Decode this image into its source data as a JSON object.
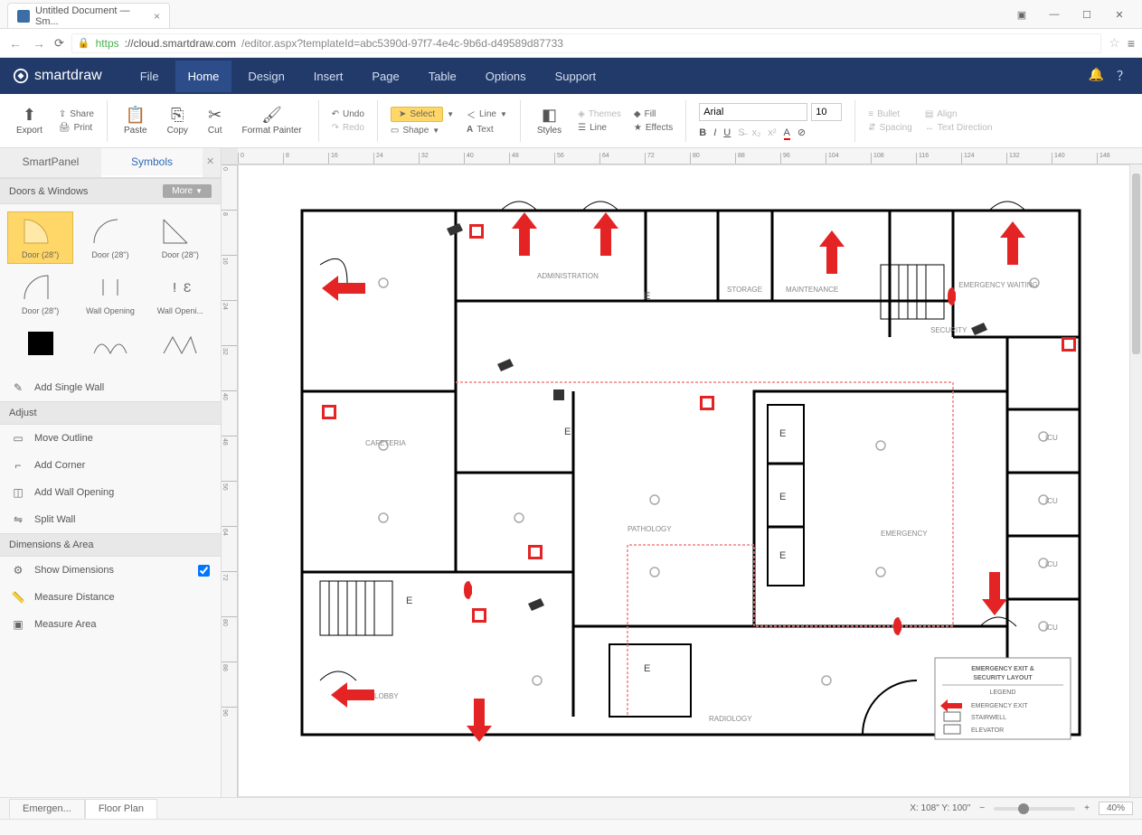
{
  "browser": {
    "tab_title": "Untitled Document — Sm...",
    "url_https": "https",
    "url_host": "://cloud.smartdraw.com",
    "url_path": "/editor.aspx?templateId=abc5390d-97f7-4e4c-9b6d-d49589d87733"
  },
  "app": {
    "brand": "smartdraw",
    "menu": [
      "File",
      "Home",
      "Design",
      "Insert",
      "Page",
      "Table",
      "Options",
      "Support"
    ],
    "menu_active": "Home"
  },
  "ribbon": {
    "export": "Export",
    "share": "Share",
    "print": "Print",
    "paste": "Paste",
    "copy": "Copy",
    "cut": "Cut",
    "format_painter": "Format Painter",
    "undo": "Undo",
    "redo": "Redo",
    "select": "Select",
    "shape": "Shape",
    "line": "Line",
    "text": "Text",
    "styles": "Styles",
    "themes": "Themes",
    "line2": "Line",
    "fill": "Fill",
    "effects": "Effects",
    "font_name": "Arial",
    "font_size": "10",
    "bullet": "Bullet",
    "align": "Align",
    "spacing": "Spacing",
    "text_direction": "Text Direction"
  },
  "sidepanel": {
    "tabs": [
      "SmartPanel",
      "Symbols"
    ],
    "tabs_active": "Symbols",
    "section_doors": "Doors & Windows",
    "more": "More",
    "symbols": [
      {
        "label": "Door (28\")",
        "selected": true
      },
      {
        "label": "Door (28\")"
      },
      {
        "label": "Door (28\")"
      },
      {
        "label": "Door (28\")"
      },
      {
        "label": "Wall Opening"
      },
      {
        "label": "Wall Openi..."
      },
      {
        "label": ""
      },
      {
        "label": ""
      },
      {
        "label": ""
      }
    ],
    "add_single_wall": "Add Single Wall",
    "section_adjust": "Adjust",
    "adjust_items": [
      "Move Outline",
      "Add Corner",
      "Add Wall Opening",
      "Split Wall"
    ],
    "section_dim": "Dimensions & Area",
    "show_dimensions": "Show Dimensions",
    "measure_distance": "Measure Distance",
    "measure_area": "Measure Area"
  },
  "canvas": {
    "rooms": {
      "administration": "ADMINISTRATION",
      "storage": "STORAGE",
      "maintenance": "MAINTENANCE",
      "security": "SECURITY",
      "emergency_waiting": "EMERGENCY WAITING",
      "cafeteria": "CAFETERIA",
      "pathology": "PATHOLOGY",
      "emergency": "EMERGENCY",
      "icu1": "ICU",
      "icu2": "ICU",
      "icu3": "ICU",
      "icu4": "ICU",
      "lobby": "LOBBY",
      "radiology": "RADIOLOGY"
    },
    "elevator_label": "E",
    "legend": {
      "title1": "EMERGENCY EXIT &",
      "title2": "SECURITY LAYOUT",
      "header": "LEGEND",
      "items": [
        "EMERGENCY EXIT",
        "STAIRWELL",
        "ELEVATOR"
      ]
    }
  },
  "status": {
    "tabs": [
      "Emergen...",
      "Floor Plan"
    ],
    "tabs_active": "Emergen...",
    "coords": "X: 108\"   Y: 100\"",
    "zoom_minus": "−",
    "zoom_plus": "+",
    "zoom_value": "40%"
  }
}
